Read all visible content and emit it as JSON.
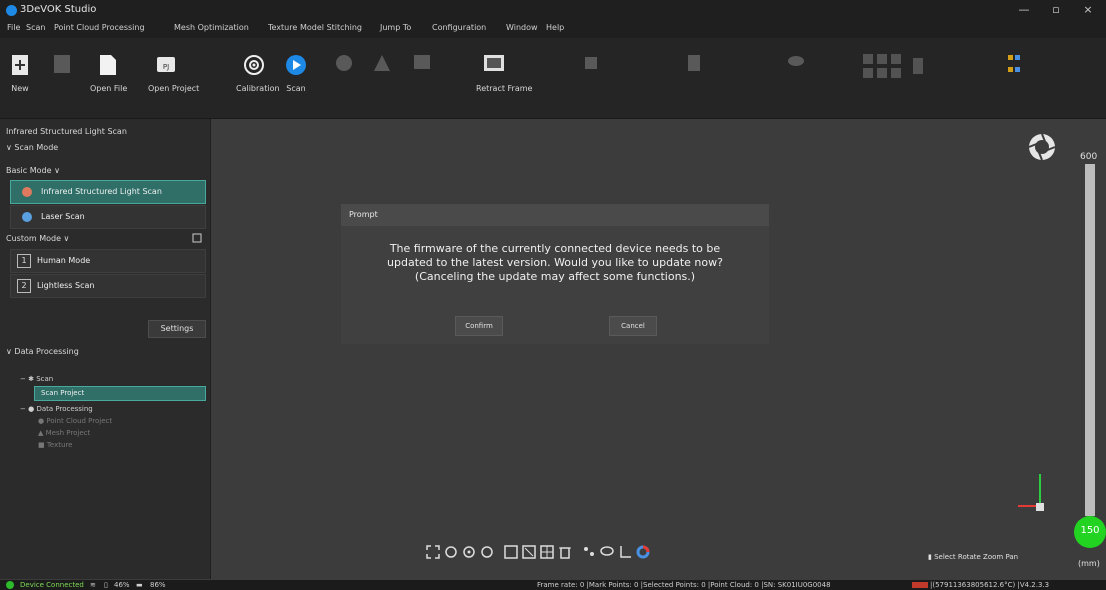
{
  "window": {
    "title": "3DeVOK Studio",
    "controls": [
      "—",
      "▫",
      "×"
    ]
  },
  "menu": [
    "File",
    "Scan",
    "Point Cloud Processing",
    "Mesh Optimization",
    "Texture",
    "Model Stitching",
    "Jump To",
    "Configuration",
    "Window",
    "Help"
  ],
  "toolbar": {
    "new": "New",
    "open_file": "Open File",
    "open_project": "Open Project",
    "calibration": "Calibration",
    "scan": "Scan",
    "retract_frame": "Retract Frame"
  },
  "left_panel": {
    "heading": "Infrared Structured Light Scan",
    "scan_mode_section": "Scan Mode",
    "basic_mode": "Basic Mode",
    "modes": [
      "Infrared Structured Light Scan",
      "Laser Scan"
    ],
    "custom_mode": "Custom Mode",
    "custom_modes": [
      {
        "number": "1",
        "label": "Human Mode"
      },
      {
        "number": "2",
        "label": "Lightless Scan"
      }
    ],
    "settings": "Settings",
    "data_processing_section": "Data Processing",
    "tree": {
      "scan": "Scan",
      "scan_project": "Scan Project",
      "data_processing": "Data Processing",
      "point_cloud_project": "Point Cloud Project",
      "mesh_project": "Mesh Project",
      "texture": "Texture"
    }
  },
  "dialog": {
    "title": "Prompt",
    "message_lines": [
      "The firmware of the currently connected device needs to be",
      "updated to the latest version. Would you like to update now?",
      "(Canceling the update may affect some functions.)"
    ],
    "confirm": "Confirm",
    "cancel": "Cancel"
  },
  "viewport": {
    "scale_top": "600",
    "scale_value": "150",
    "scale_unit": "(mm)",
    "mouse_hints": "Select  Rotate  Zoom  Pan"
  },
  "status": {
    "device": "Device Connected",
    "battery1": "46%",
    "battery2": "86%",
    "info": "Frame rate: 0 |Mark Points: 0 |Selected Points: 0 |Point Cloud: 0 |SN: SK01IU0G0048",
    "info2": "|(57911363805612.6°C) |V4.2.3.3"
  },
  "colors": {
    "accent": "#2f6f68",
    "accent_border": "#48a89b",
    "scan_blue": "#1e88e5",
    "scale_green": "#22d322",
    "status_green": "#2dbb2d"
  }
}
